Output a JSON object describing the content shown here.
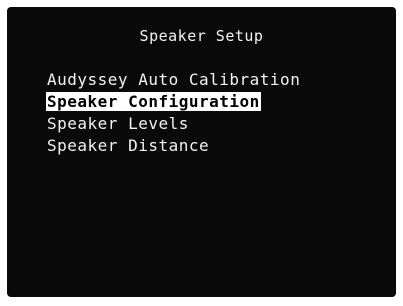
{
  "screen": {
    "title": "Speaker Setup",
    "menu_items": [
      {
        "label": "Audyssey Auto Calibration",
        "selected": false
      },
      {
        "label": "Speaker Configuration",
        "selected": true
      },
      {
        "label": "Speaker Levels",
        "selected": false
      },
      {
        "label": "Speaker Distance",
        "selected": false
      }
    ]
  },
  "colors": {
    "background": "#0a0a0a",
    "text": "#f2f2f2",
    "highlight_bg": "#ffffff",
    "highlight_text": "#000000"
  }
}
